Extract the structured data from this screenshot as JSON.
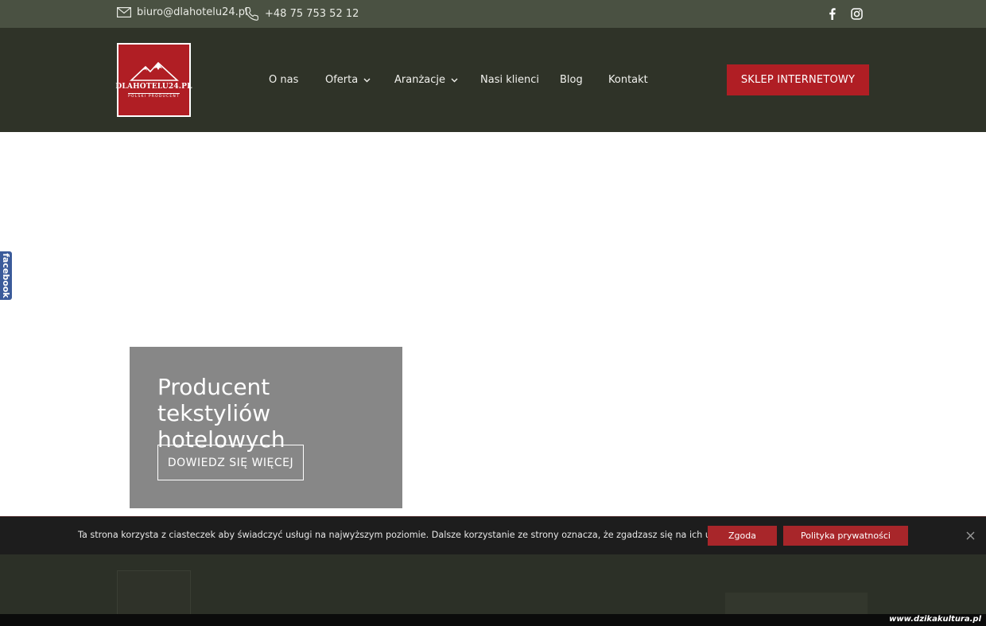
{
  "topbar": {
    "email": "biuro@dlahotelu24.pl",
    "phone": "+48 75 753 52 12",
    "social_icons": [
      "facebook-icon",
      "instagram-icon"
    ]
  },
  "header": {
    "logo": {
      "name": "DLAHOTELU24.PL",
      "subtitle": "POLSKI PRODUCENT"
    },
    "nav": [
      {
        "label": "O nas"
      },
      {
        "label": "Oferta"
      },
      {
        "label": "Aranżacje"
      },
      {
        "label": "Nasi klienci"
      },
      {
        "label": "Blog"
      },
      {
        "label": "Kontakt"
      }
    ],
    "shop_button": "SKLEP INTERNETOWY"
  },
  "hero": {
    "title": "Producent tekstyliów hotelowych",
    "button": "DOWIEDZ SIĘ WIĘCEJ"
  },
  "facebook_tab": "facebook",
  "cookie": {
    "message": "Ta strona korzysta z ciasteczek aby świadczyć usługi na najwyższym poziomie. Dalsze korzystanie ze strony oznacza, że zgadzasz się na ich użycie.",
    "accept": "Zgoda",
    "policy": "Polityka prywatności"
  },
  "watermark": "www.dzikakultura.pl",
  "colors": {
    "topbar": "#4a5142",
    "header": "#2f3328",
    "accent_red": "#b01e24",
    "hero_box": "#878787",
    "cookie_bar": "#1d1d1d",
    "facebook_blue": "#3b5b9a"
  }
}
